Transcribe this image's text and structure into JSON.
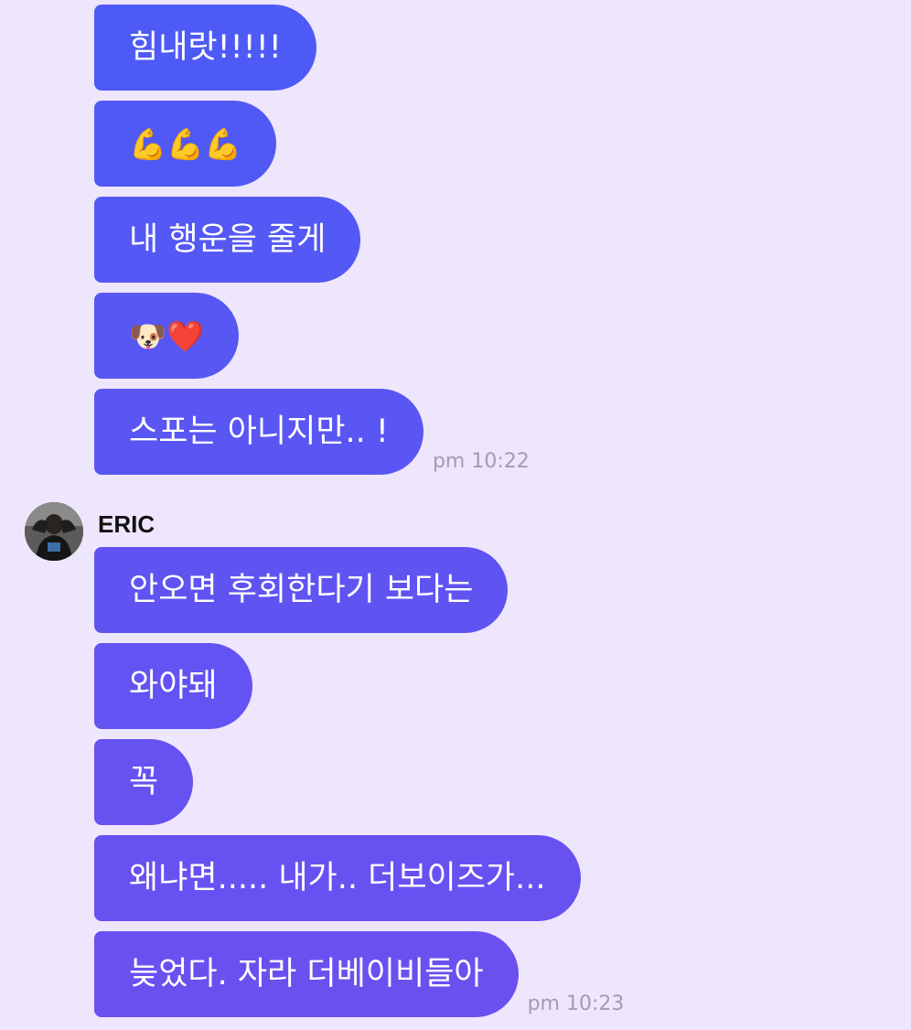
{
  "colors": {
    "background": "#EEE6FD",
    "bubble_top": "#4C5BF5",
    "bubble_bottom": "#6D4FF0",
    "timestamp": "#A19CB5",
    "name": "#111111"
  },
  "group1": {
    "messages": [
      {
        "text": "힘내랏!!!!!"
      },
      {
        "text": "💪💪💪"
      },
      {
        "text": "내 행운을 줄게"
      },
      {
        "text": "🐶❤️"
      },
      {
        "text": "스포는 아니지만.. !"
      }
    ],
    "timestamp": "pm 10:22"
  },
  "group2": {
    "sender": "ERIC",
    "avatar_icon": "profile-photo",
    "messages": [
      {
        "text": "안오면 후회한다기 보다는"
      },
      {
        "text": "와야돼"
      },
      {
        "text": "꼭"
      },
      {
        "text": "왜냐면..... 내가.. 더보이즈가..."
      },
      {
        "text": "늦었다. 자라 더베이비들아"
      }
    ],
    "timestamp": "pm 10:23"
  }
}
